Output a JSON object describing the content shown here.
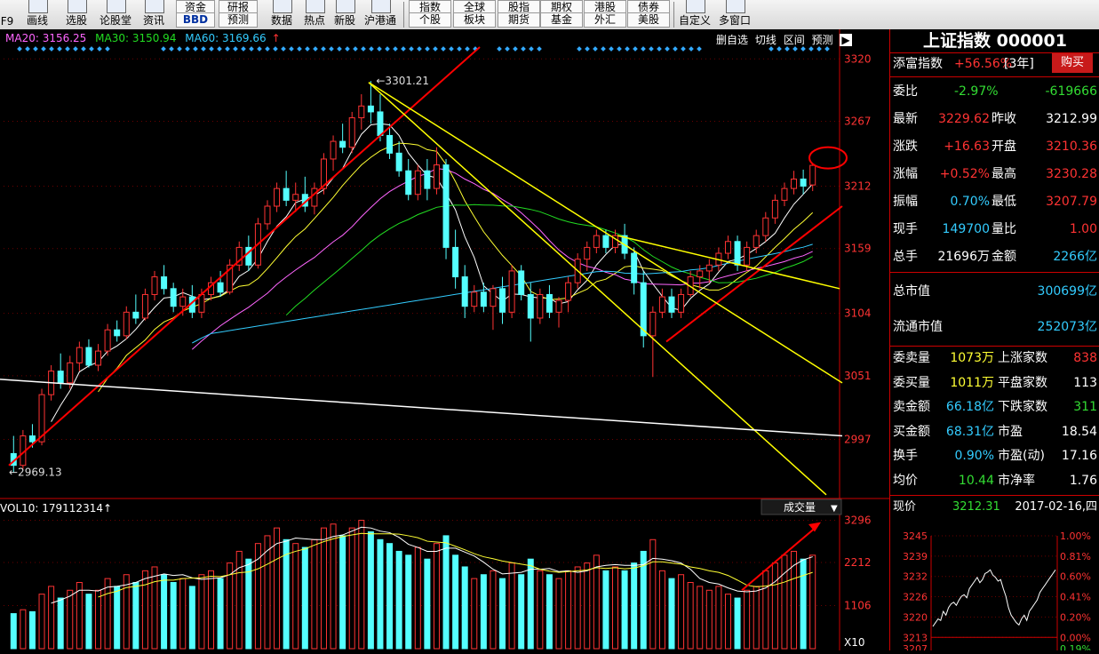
{
  "toolbar": {
    "items": [
      "F9",
      "画线",
      "选股",
      "论股堂",
      "资讯",
      "数据",
      "热点",
      "新股",
      "沪港通",
      "自定义",
      "多窗口"
    ],
    "top_buttons": [
      "资金",
      "研报",
      "指数",
      "全球",
      "股指",
      "期权",
      "港股",
      "债券"
    ],
    "bbd_label": "BBD",
    "forecast_label": "预测",
    "market_buttons": [
      "个股",
      "板块",
      "期货",
      "基金",
      "外汇",
      "美股"
    ]
  },
  "chart": {
    "ma20": "MA20: 3156.25",
    "ma30": "MA30: 3150.94",
    "ma60": "MA60: 3169.66",
    "arrow": "↑",
    "tabs": [
      "删自选",
      "切线",
      "区间",
      "预测"
    ],
    "price_ticks": [
      "3320",
      "3267",
      "3212",
      "3159",
      "3104",
      "3051",
      "2997"
    ],
    "high_label": "3301.21",
    "low_label": "2969.13",
    "vol_label": "VOL10: 179112314",
    "vol_selector": "成交量",
    "vol_ticks": [
      "3296",
      "2212",
      "1106"
    ],
    "vol_unit": "X10",
    "colors": {
      "up": "#ff3333",
      "down": "#54ffff",
      "ma5": "#ffffff",
      "ma10": "#ffff33",
      "ma20": "#ff66ff",
      "ma30": "#22dd22",
      "ma60": "#33ccff",
      "trend_red": "#ff0000",
      "trend_yellow": "#ffff00"
    }
  },
  "chart_data": {
    "type": "candlestick",
    "title": "",
    "ylim": [
      2969.13,
      3320
    ],
    "ohlc": [
      [
        2985,
        3000,
        2969,
        2975
      ],
      [
        2975,
        3005,
        2972,
        3000
      ],
      [
        3000,
        3010,
        2990,
        2995
      ],
      [
        2995,
        3040,
        2992,
        3035
      ],
      [
        3035,
        3060,
        3030,
        3055
      ],
      [
        3055,
        3070,
        3040,
        3045
      ],
      [
        3045,
        3068,
        3040,
        3062
      ],
      [
        3062,
        3080,
        3055,
        3075
      ],
      [
        3075,
        3082,
        3058,
        3060
      ],
      [
        3060,
        3078,
        3055,
        3072
      ],
      [
        3072,
        3095,
        3068,
        3090
      ],
      [
        3090,
        3098,
        3080,
        3085
      ],
      [
        3085,
        3110,
        3082,
        3105
      ],
      [
        3105,
        3120,
        3095,
        3100
      ],
      [
        3100,
        3125,
        3098,
        3120
      ],
      [
        3120,
        3140,
        3115,
        3135
      ],
      [
        3135,
        3145,
        3120,
        3125
      ],
      [
        3125,
        3130,
        3105,
        3110
      ],
      [
        3110,
        3125,
        3102,
        3118
      ],
      [
        3118,
        3128,
        3100,
        3105
      ],
      [
        3105,
        3125,
        3100,
        3120
      ],
      [
        3120,
        3135,
        3115,
        3130
      ],
      [
        3130,
        3140,
        3118,
        3122
      ],
      [
        3122,
        3150,
        3120,
        3145
      ],
      [
        3145,
        3165,
        3140,
        3160
      ],
      [
        3160,
        3170,
        3140,
        3145
      ],
      [
        3145,
        3185,
        3142,
        3180
      ],
      [
        3180,
        3200,
        3175,
        3195
      ],
      [
        3195,
        3215,
        3190,
        3210
      ],
      [
        3210,
        3225,
        3195,
        3200
      ],
      [
        3200,
        3215,
        3190,
        3205
      ],
      [
        3205,
        3220,
        3190,
        3195
      ],
      [
        3195,
        3215,
        3188,
        3210
      ],
      [
        3210,
        3240,
        3205,
        3235
      ],
      [
        3235,
        3255,
        3225,
        3250
      ],
      [
        3250,
        3265,
        3240,
        3245
      ],
      [
        3245,
        3275,
        3240,
        3270
      ],
      [
        3270,
        3290,
        3260,
        3280
      ],
      [
        3280,
        3301.21,
        3265,
        3275
      ],
      [
        3275,
        3290,
        3250,
        3255
      ],
      [
        3255,
        3265,
        3235,
        3240
      ],
      [
        3240,
        3250,
        3220,
        3225
      ],
      [
        3225,
        3235,
        3200,
        3205
      ],
      [
        3205,
        3230,
        3200,
        3225
      ],
      [
        3225,
        3235,
        3200,
        3210
      ],
      [
        3210,
        3245,
        3205,
        3230
      ],
      [
        3230,
        3235,
        3150,
        3160
      ],
      [
        3160,
        3175,
        3125,
        3135
      ],
      [
        3135,
        3145,
        3100,
        3110
      ],
      [
        3110,
        3128,
        3105,
        3122
      ],
      [
        3122,
        3130,
        3105,
        3110
      ],
      [
        3110,
        3128,
        3090,
        3125
      ],
      [
        3125,
        3135,
        3095,
        3105
      ],
      [
        3105,
        3145,
        3100,
        3140
      ],
      [
        3140,
        3145,
        3115,
        3120
      ],
      [
        3120,
        3130,
        3080,
        3100
      ],
      [
        3100,
        3125,
        3095,
        3120
      ],
      [
        3120,
        3128,
        3100,
        3105
      ],
      [
        3105,
        3118,
        3092,
        3115
      ],
      [
        3115,
        3135,
        3105,
        3130
      ],
      [
        3130,
        3155,
        3125,
        3150
      ],
      [
        3150,
        3165,
        3140,
        3160
      ],
      [
        3160,
        3175,
        3155,
        3170
      ],
      [
        3170,
        3175,
        3155,
        3160
      ],
      [
        3160,
        3175,
        3155,
        3170
      ],
      [
        3170,
        3180,
        3150,
        3155
      ],
      [
        3155,
        3160,
        3120,
        3130
      ],
      [
        3130,
        3140,
        3075,
        3085
      ],
      [
        3085,
        3110,
        3050,
        3105
      ],
      [
        3105,
        3125,
        3100,
        3118
      ],
      [
        3118,
        3125,
        3100,
        3105
      ],
      [
        3105,
        3125,
        3100,
        3120
      ],
      [
        3120,
        3140,
        3118,
        3135
      ],
      [
        3135,
        3145,
        3125,
        3140
      ],
      [
        3140,
        3150,
        3130,
        3145
      ],
      [
        3145,
        3160,
        3140,
        3155
      ],
      [
        3155,
        3170,
        3150,
        3165
      ],
      [
        3165,
        3170,
        3140,
        3145
      ],
      [
        3145,
        3165,
        3140,
        3160
      ],
      [
        3160,
        3175,
        3155,
        3170
      ],
      [
        3170,
        3190,
        3165,
        3185
      ],
      [
        3185,
        3205,
        3180,
        3200
      ],
      [
        3200,
        3215,
        3195,
        3210
      ],
      [
        3210,
        3225,
        3205,
        3218
      ],
      [
        3218,
        3226,
        3205,
        3212
      ],
      [
        3212.99,
        3230.28,
        3207.79,
        3229.62
      ]
    ],
    "volume": [
      900,
      1000,
      950,
      1400,
      1600,
      1300,
      1500,
      1700,
      1400,
      1500,
      1800,
      1600,
      1900,
      1700,
      2000,
      2100,
      1900,
      1700,
      1800,
      1600,
      1900,
      2000,
      1800,
      2200,
      2500,
      2300,
      2700,
      2900,
      3100,
      2800,
      2700,
      2600,
      2800,
      3100,
      3200,
      2900,
      3100,
      3296,
      3000,
      2800,
      2700,
      2500,
      2400,
      2600,
      2300,
      2700,
      2900,
      2400,
      2100,
      1800,
      1900,
      2000,
      1800,
      2200,
      1900,
      2300,
      2000,
      1900,
      1800,
      2000,
      2100,
      2200,
      2400,
      2000,
      2100,
      2000,
      2200,
      2500,
      2800,
      2000,
      1800,
      1900,
      1700,
      1600,
      1500,
      1600,
      1400,
      1300,
      1500,
      1600,
      2000,
      2200,
      2400,
      2500,
      2300,
      2400
    ]
  },
  "panel": {
    "title": "上证指数 000001",
    "tianfu_label": "添富指数",
    "tianfu_value": "+56.56%",
    "tianfu_period": "[3年]",
    "buy_button": "购买",
    "rows": [
      {
        "k": "委比",
        "v1": "-2.97%",
        "v2": "-619666"
      },
      {
        "k": "最新",
        "v1": "3229.62",
        "k2": "昨收",
        "v2": "3212.99"
      },
      {
        "k": "涨跌",
        "v1": "+16.63",
        "k2": "开盘",
        "v2": "3210.36"
      },
      {
        "k": "涨幅",
        "v1": "+0.52%",
        "k2": "最高",
        "v2": "3230.28"
      },
      {
        "k": "振幅",
        "v1": "0.70%",
        "k2": "最低",
        "v2": "3207.79"
      },
      {
        "k": "现手",
        "v1": "149700",
        "k2": "量比",
        "v2": "1.00"
      },
      {
        "k": "总手",
        "v1": "21696万",
        "k2": "金额",
        "v2": "2266亿"
      }
    ],
    "total_mv_label": "总市值",
    "total_mv": "300699亿",
    "float_mv_label": "流通市值",
    "float_mv": "252073亿",
    "stats": [
      {
        "k": "委卖量",
        "v1": "1073万",
        "k2": "上涨家数",
        "v2": "838"
      },
      {
        "k": "委买量",
        "v1": "1011万",
        "k2": "平盘家数",
        "v2": "113"
      },
      {
        "k": "卖金额",
        "v1": "66.18亿",
        "k2": "下跌家数",
        "v2": "311"
      },
      {
        "k": "买金额",
        "v1": "68.31亿",
        "k2": "市盈",
        "v2": "18.54"
      },
      {
        "k": "换手",
        "v1": "0.90%",
        "k2": "市盈(动)",
        "v2": "17.16"
      },
      {
        "k": "均价",
        "v1": "10.44",
        "k2": "市净率",
        "v2": "1.76"
      }
    ],
    "current_label": "现价",
    "current_value": "3212.31",
    "date": "2017-02-16,四",
    "mini_left": [
      "3245",
      "3239",
      "3232",
      "3226",
      "3220",
      "3213"
    ],
    "mini_right": [
      "1.00%",
      "0.81%",
      "0.60%",
      "0.41%",
      "0.20%",
      "0.00%"
    ],
    "mini_bottom_right": "0.19%",
    "mini_bottom_left": "3207"
  }
}
